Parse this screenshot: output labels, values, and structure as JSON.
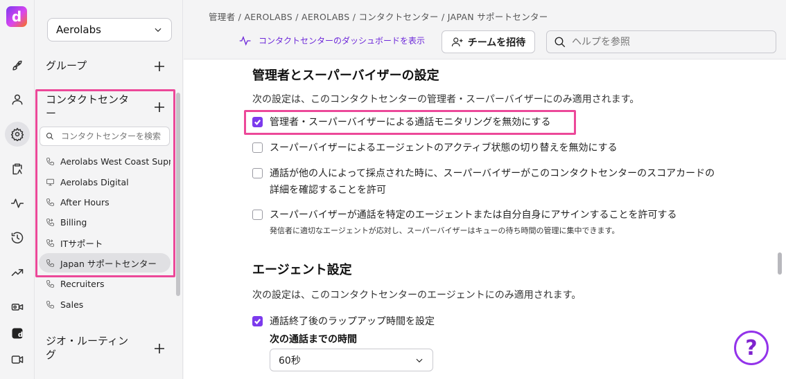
{
  "app": {
    "logo_letter": "d"
  },
  "rail": {
    "icons": [
      "rocket-icon",
      "user-icon",
      "gear-icon",
      "clipboard-icon",
      "activity-icon",
      "history-icon",
      "trending-icon",
      "video-settings-icon",
      "ai-icon",
      "video-icon"
    ],
    "active": "gear-icon"
  },
  "sidebar": {
    "workspace": "Aerolabs",
    "groups_label": "グループ",
    "contact_center_label": "コンタクトセンタ\nー",
    "contact_center_line1": "コンタクトセンタ",
    "contact_center_line2": "ー",
    "search_placeholder": "コンタクトセンターを検索",
    "items": [
      {
        "label": "Aerolabs West Coast Supp...",
        "icon": "phone-icon"
      },
      {
        "label": "Aerolabs Digital",
        "icon": "monitor-icon"
      },
      {
        "label": "After Hours",
        "icon": "phone-icon"
      },
      {
        "label": "Billing",
        "icon": "phone-forward-icon"
      },
      {
        "label": "ITサポート",
        "icon": "phone-forward-icon"
      },
      {
        "label": "Japan サポートセンター",
        "icon": "phone-icon"
      },
      {
        "label": "Recruiters",
        "icon": "phone-icon"
      },
      {
        "label": "Sales",
        "icon": "phone-icon"
      }
    ],
    "selected_index": 5,
    "geo_routing_line1": "ジオ・ルーティン",
    "geo_routing_line2": "グ"
  },
  "header": {
    "breadcrumb": "管理者 / AEROLABS / AEROLABS / コンタクトセンター / JAPAN サポートセンター",
    "dashboard_link": "コンタクトセンターのダッシュボードを表示",
    "invite_button": "チームを招待",
    "help_placeholder": "ヘルプを参照"
  },
  "admin_section": {
    "title": "管理者とスーパーバイザーの設定",
    "description": "次の設定は、このコンタクトセンターの管理者・スーパーバイザーにのみ適用されます。",
    "options": [
      {
        "label": "管理者・スーパーバイザーによる通話モニタリングを無効にする",
        "checked": true
      },
      {
        "label": "スーパーバイザーによるエージェントのアクティブ状態の切り替えを無効にする",
        "checked": false
      },
      {
        "label_line1": "通話が他の人によって採点された時に、スーパーバイザーがこのコンタクトセンターのスコアカードの",
        "label_line2": "詳細を確認することを許可",
        "checked": false
      },
      {
        "label": "スーパーバイザーが通話を特定のエージェントまたは自分自身にアサインすることを許可する",
        "note": "発信者に適切なエージェントが応対し、スーパーバイザーはキューの待ち時間の管理に集中できます。",
        "checked": false
      }
    ]
  },
  "agent_section": {
    "title": "エージェント設定",
    "description": "次の設定は、このコンタクトセンターのエージェントにのみ適用されます。",
    "wrapup_label": "通話終了後のラップアップ時間を設定",
    "wrapup_checked": true,
    "next_call_label": "次の通話までの時間",
    "next_call_value": "60秒"
  },
  "help_fab": "?",
  "colors": {
    "accent": "#7c3aed",
    "highlight": "#ec4899"
  }
}
